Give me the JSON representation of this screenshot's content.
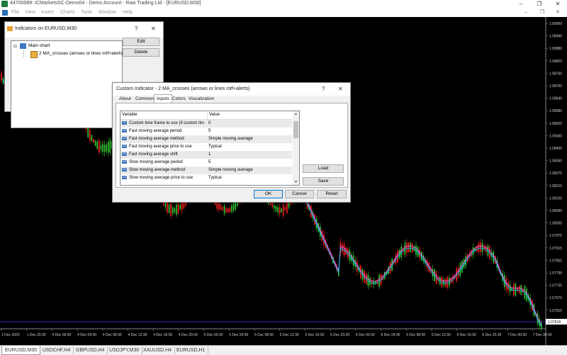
{
  "window": {
    "title": "44700089: ICMarketsSC-Demo04 - Demo Account - Raw Trading Ltd - [EURUSD,M30]",
    "minimize": "–",
    "restore": "❐",
    "close": "✕"
  },
  "menu": [
    "File",
    "View",
    "Insert",
    "Charts",
    "Tools",
    "Window",
    "Help"
  ],
  "mdi_controls": {
    "minimize": "–",
    "restore": "❐",
    "close": "✕"
  },
  "indicators_window": {
    "title": "Indicators on EURUSD,M30",
    "help": "?",
    "close": "✕",
    "tree_root": "Main chart",
    "tree_child": "2 MA_crosses (arrows or lines mtf+alerts)",
    "edit_label": "Edit",
    "delete_label": "Delete"
  },
  "dialog": {
    "title": "Custom Indicator - 2 MA_crosses (arrows or lines mtf+alerts)",
    "help": "?",
    "close": "✕",
    "tabs": [
      "About",
      "Common",
      "Inputs",
      "Colors",
      "Visualization"
    ],
    "active_tab": "Inputs",
    "col_variable": "Variable",
    "col_value": "Value",
    "rows": [
      {
        "icon": "01",
        "variable": "Custom time frame to use (if custom tim...",
        "value": "0"
      },
      {
        "icon": "123",
        "variable": "Fast moving average period",
        "value": "5"
      },
      {
        "icon": "123",
        "variable": "Fast moving average method",
        "value": "Simple moving average"
      },
      {
        "icon": "123",
        "variable": "Fast moving average price to use",
        "value": "Typical"
      },
      {
        "icon": "123",
        "variable": "Fast moving average shift",
        "value": "1"
      },
      {
        "icon": "123",
        "variable": "Slow moving average period",
        "value": "5"
      },
      {
        "icon": "123",
        "variable": "Slow moving average method",
        "value": "Simple moving average"
      },
      {
        "icon": "123",
        "variable": "Slow moving average price to use",
        "value": "Typical"
      }
    ],
    "load_label": "Load",
    "save_label": "Save",
    "ok_label": "OK",
    "cancel_label": "Cancel",
    "reset_label": "Reset"
  },
  "chart": {
    "price_labels": [
      "1.09000",
      "1.08940",
      "1.08880",
      "1.08820",
      "1.08760",
      "1.08700",
      "1.08640",
      "1.08580",
      "1.08520",
      "1.08460",
      "1.08400",
      "1.08340",
      "1.08275",
      "1.08215",
      "1.08155",
      "1.08095",
      "1.08035",
      "1.07975",
      "1.07915",
      "1.07855",
      "1.07795",
      "1.07735",
      "1.07675",
      "1.07615",
      "1.07555"
    ],
    "current_price": "1.07618",
    "time_labels": [
      "1 Dec 2023",
      "1 Dec 20:30",
      "4 Dec 00:30",
      "4 Dec 04:30",
      "4 Dec 08:30",
      "4 Dec 12:30",
      "4 Dec 16:30",
      "4 Dec 20:30",
      "5 Dec 00:30",
      "5 Dec 04:30",
      "5 Dec 08:30",
      "5 Dec 12:30",
      "5 Dec 16:30",
      "5 Dec 20:30",
      "6 Dec 00:30",
      "6 Dec 04:30",
      "6 Dec 08:30",
      "6 Dec 12:30",
      "6 Dec 16:30",
      "6 Dec 20:30",
      "7 Dec 00:30",
      "7 Dec 04:30"
    ],
    "colors": {
      "up": "#33cc33",
      "down": "#ff2020",
      "fast_ma": "#ff66ff",
      "slow_ma": "#00ccff",
      "price_line": "#3a3aff"
    }
  },
  "tabs": [
    "EURUSD,M30",
    "USDCHF,H4",
    "GBPUSD,H4",
    "USDJPY,M30",
    "XAUUSD,H4",
    "EURUSD,H1"
  ],
  "active_tab": "EURUSD,M30"
}
